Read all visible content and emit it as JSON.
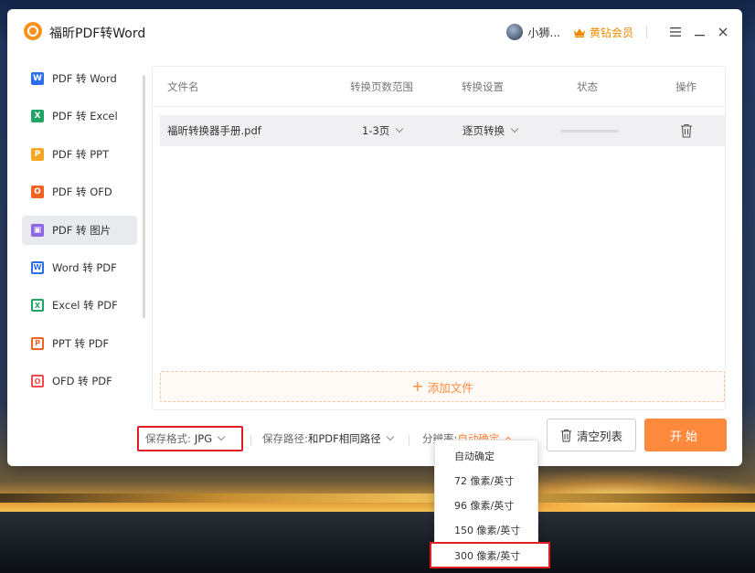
{
  "app": {
    "title": "福昕PDF转Word",
    "user_name": "小狮...",
    "vip_label": "黄钻会员"
  },
  "sidebar": {
    "items": [
      {
        "label": "PDF 转 Word",
        "icon": "word-icon",
        "icon_text": "W",
        "color": "#2b6ee6",
        "active": false,
        "outline": false
      },
      {
        "label": "PDF 转 Excel",
        "icon": "excel-icon",
        "icon_text": "X",
        "color": "#1fa463",
        "active": false,
        "outline": false
      },
      {
        "label": "PDF 转 PPT",
        "icon": "ppt-icon",
        "icon_text": "P",
        "color": "#f5a623",
        "active": false,
        "outline": false
      },
      {
        "label": "PDF 转 OFD",
        "icon": "ofd-icon",
        "icon_text": "O",
        "color": "#f06222",
        "active": false,
        "outline": false
      },
      {
        "label": "PDF 转 图片",
        "icon": "image-icon",
        "icon_text": "▣",
        "color": "#8e67e6",
        "active": true,
        "outline": false
      },
      {
        "label": "Word 转 PDF",
        "icon": "word-to-pdf-icon",
        "icon_text": "W",
        "color": "#2b6ee6",
        "active": false,
        "outline": true
      },
      {
        "label": "Excel 转 PDF",
        "icon": "excel-to-pdf-icon",
        "icon_text": "X",
        "color": "#1fa463",
        "active": false,
        "outline": true
      },
      {
        "label": "PPT 转 PDF",
        "icon": "ppt-to-pdf-icon",
        "icon_text": "P",
        "color": "#f06222",
        "active": false,
        "outline": true
      },
      {
        "label": "OFD 转 PDF",
        "icon": "ofd-to-pdf-icon",
        "icon_text": "O",
        "color": "#f04a4a",
        "active": false,
        "outline": true
      }
    ]
  },
  "table": {
    "headers": {
      "filename": "文件名",
      "page_range": "转换页数范围",
      "settings": "转换设置",
      "status": "状态",
      "actions": "操作"
    },
    "rows": [
      {
        "filename": "福昕转换器手册.pdf",
        "page_range": "1-3页",
        "settings": "逐页转换",
        "progress": 0
      }
    ]
  },
  "add_file_label": "添加文件",
  "bottom": {
    "format_label": "保存格式:",
    "format_value": "JPG",
    "path_label": "保存路径:",
    "path_value": "和PDF相同路径",
    "resolution_label": "分辨率:",
    "resolution_value": "自动确定",
    "clear_label": "清空列表",
    "start_label": "开始"
  },
  "resolution_options": [
    {
      "label": "自动确定",
      "selected": false
    },
    {
      "label": "72 像素/英寸",
      "selected": false
    },
    {
      "label": "96 像素/英寸",
      "selected": false
    },
    {
      "label": "150 像素/英寸",
      "selected": false
    },
    {
      "label": "300 像素/英寸",
      "selected": true
    }
  ],
  "colors": {
    "accent": "#ff8a3d",
    "highlight_box": "#e02020",
    "vip": "#f08a00"
  }
}
